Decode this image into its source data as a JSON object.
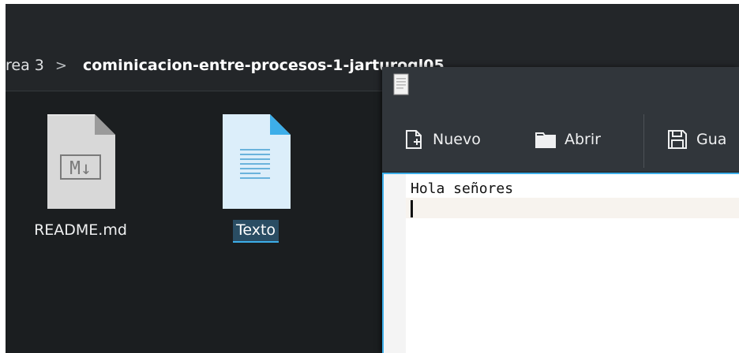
{
  "file_manager": {
    "breadcrumb": {
      "parent": "rea 3",
      "separator": ">",
      "current": "cominicacion-entre-procesos-1-jarturogl05"
    },
    "files": [
      {
        "name": "README.md",
        "icon": "markdown-file-icon",
        "icon_text": "M↓"
      },
      {
        "name": "Texto",
        "icon": "text-file-icon",
        "selected": true
      }
    ]
  },
  "editor": {
    "window_icon": "text-document-icon",
    "toolbar": {
      "new_label": "Nuevo",
      "open_label": "Abrir",
      "save_label": "Gua"
    },
    "content": "Hola señores",
    "colors": {
      "accent": "#3daee9",
      "toolbar_bg": "#31363b",
      "file_manager_bg": "#1b1e20"
    }
  }
}
